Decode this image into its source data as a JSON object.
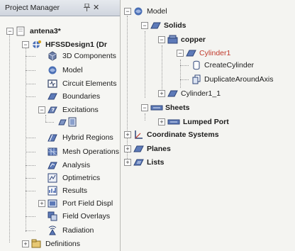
{
  "project_manager": {
    "title": "Project Manager",
    "pin_icon": "pin-icon",
    "close_label": "✕",
    "items": [
      {
        "label": "antena3*"
      },
      {
        "label": "HFSSDesign1 (Dr"
      },
      {
        "label": "3D Components"
      },
      {
        "label": "Model"
      },
      {
        "label": "Circuit Elements"
      },
      {
        "label": "Boundaries"
      },
      {
        "label": "Excitations"
      },
      {
        "label": ""
      },
      {
        "label": "Hybrid Regions"
      },
      {
        "label": "Mesh Operations"
      },
      {
        "label": "Analysis"
      },
      {
        "label": "Optimetrics"
      },
      {
        "label": "Results"
      },
      {
        "label": "Port Field Displ"
      },
      {
        "label": "Field Overlays"
      },
      {
        "label": "Radiation"
      },
      {
        "label": "Definitions"
      }
    ]
  },
  "model_tree": {
    "items": [
      {
        "label": "Model"
      },
      {
        "label": "Solids"
      },
      {
        "label": "copper"
      },
      {
        "label": "Cylinder1"
      },
      {
        "label": "CreateCylinder"
      },
      {
        "label": "DuplicateAroundAxis"
      },
      {
        "label": "Cylinder1_1"
      },
      {
        "label": "Sheets"
      },
      {
        "label": "Lumped Port"
      },
      {
        "label": "Coordinate Systems"
      },
      {
        "label": "Planes"
      },
      {
        "label": "Lists"
      }
    ]
  },
  "colors": {
    "accent_blue": "#3b5da8",
    "cylinder_red": "#c0392b",
    "panel_bg": "#f6f6f3"
  }
}
